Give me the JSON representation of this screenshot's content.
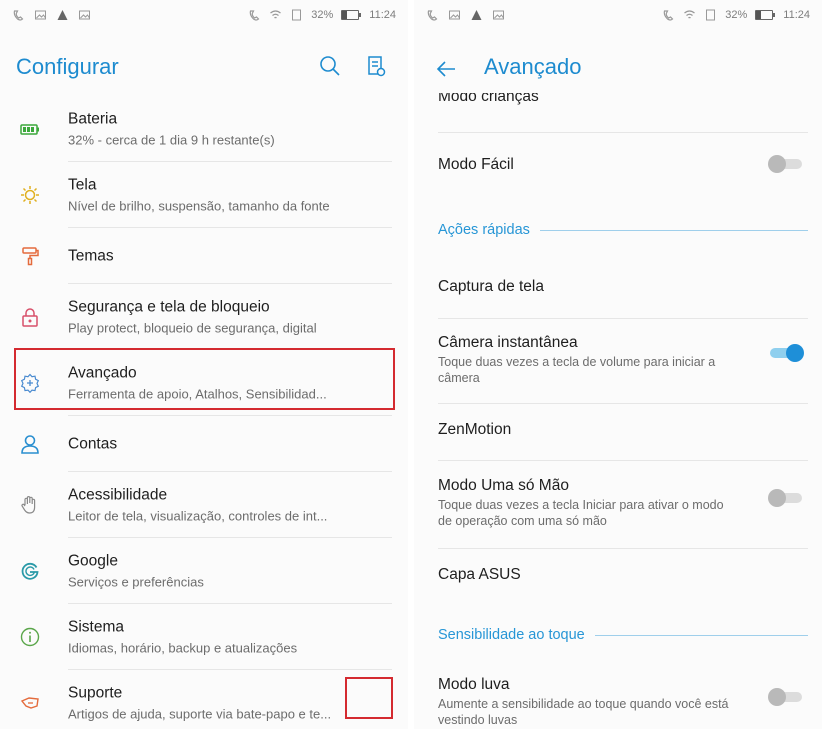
{
  "status_bar": {
    "battery_text": "32%",
    "time": "11:24",
    "battery_level": 0.32
  },
  "left_screen": {
    "title": "Configurar",
    "items": [
      {
        "icon": "battery-icon",
        "title": "Bateria",
        "subtitle": "32% - cerca de 1 dia 9 h restante(s)"
      },
      {
        "icon": "brightness-icon",
        "title": "Tela",
        "subtitle": "Nível de brilho, suspensão, tamanho da fonte"
      },
      {
        "icon": "paint-roller-icon",
        "title": "Temas",
        "subtitle": ""
      },
      {
        "icon": "lock-icon",
        "title": "Segurança e tela de bloqueio",
        "subtitle": "Play protect, bloqueio de segurança, digital"
      },
      {
        "icon": "advanced-gear-icon",
        "title": "Avançado",
        "subtitle": "Ferramenta de apoio, Atalhos, Sensibilidad..."
      },
      {
        "icon": "person-icon",
        "title": "Contas",
        "subtitle": ""
      },
      {
        "icon": "hand-icon",
        "title": "Acessibilidade",
        "subtitle": "Leitor de tela, visualização, controles de int..."
      },
      {
        "icon": "google-icon",
        "title": "Google",
        "subtitle": "Serviços e preferências"
      },
      {
        "icon": "info-icon",
        "title": "Sistema",
        "subtitle": "Idiomas, horário, backup e atualizações"
      },
      {
        "icon": "support-icon",
        "title": "Suporte",
        "subtitle": "Artigos de ajuda, suporte via bate-papo e te..."
      }
    ]
  },
  "right_screen": {
    "title": "Avançado",
    "partial_item": "Modo crianças",
    "modo_facil": {
      "title": "Modo Fácil",
      "enabled": false
    },
    "section_quick_actions": "Ações rápidas",
    "captura": {
      "title": "Captura de tela"
    },
    "camera": {
      "title": "Câmera instantânea",
      "subtitle": "Toque duas vezes a tecla de volume para iniciar a câmera",
      "enabled": true
    },
    "zenmotion": {
      "title": "ZenMotion"
    },
    "uma_mao": {
      "title": "Modo Uma só Mão",
      "subtitle": "Toque duas vezes a tecla Iniciar para ativar o modo de operação com uma só mão",
      "enabled": false
    },
    "capa": {
      "title": "Capa ASUS"
    },
    "section_touch": "Sensibilidade ao toque",
    "luva": {
      "title": "Modo luva",
      "subtitle": "Aumente a sensibilidade ao toque quando você está vestindo luvas",
      "enabled": false
    }
  },
  "colors": {
    "accent": "#1d8bcf",
    "highlight": "#d42a30",
    "toggle_on": "#1e8fd8"
  }
}
